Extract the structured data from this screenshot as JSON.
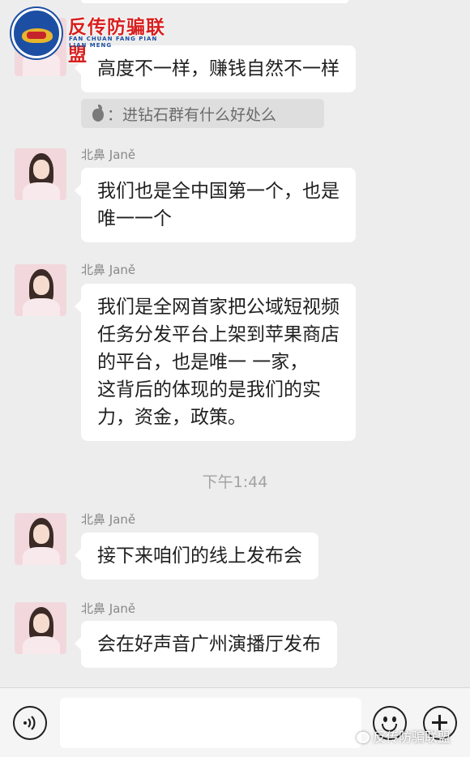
{
  "logo": {
    "title": "反传防骗联盟",
    "subtitle": "FAN CHUAN FANG PIAN LIAN MENG"
  },
  "messages": [
    {
      "sender": "",
      "text": "高度不一样，赚钱自然不一样"
    },
    {
      "sender": "北鼻 Janě",
      "text": "我们也是全中国第一个，也是\n唯一一个"
    },
    {
      "sender": "北鼻 Janě",
      "text": "我们是全网首家把公域短视频\n任务分发平台上架到苹果商店\n的平台，也是唯一 一家，\n这背后的体现的是我们的实\n力，资金，政策。"
    },
    {
      "sender": "北鼻 Janě",
      "text": "接下来咱们的线上发布会"
    },
    {
      "sender": "北鼻 Janě",
      "text": "会在好声音广州演播厅发布"
    }
  ],
  "quote": {
    "icon": "apple-icon",
    "text": "：进钻石群有什么好处么"
  },
  "timestamp": "下午1:44",
  "input_bar": {
    "voice_icon": "voice-icon",
    "emoji_icon": "emoji-icon",
    "plus_icon": "plus-icon",
    "placeholder": ""
  },
  "watermark": "反传防骗联盟",
  "colors": {
    "background": "#ededed",
    "bubble": "#ffffff",
    "logo_red": "#d7201f",
    "logo_blue": "#1c4fa3"
  }
}
